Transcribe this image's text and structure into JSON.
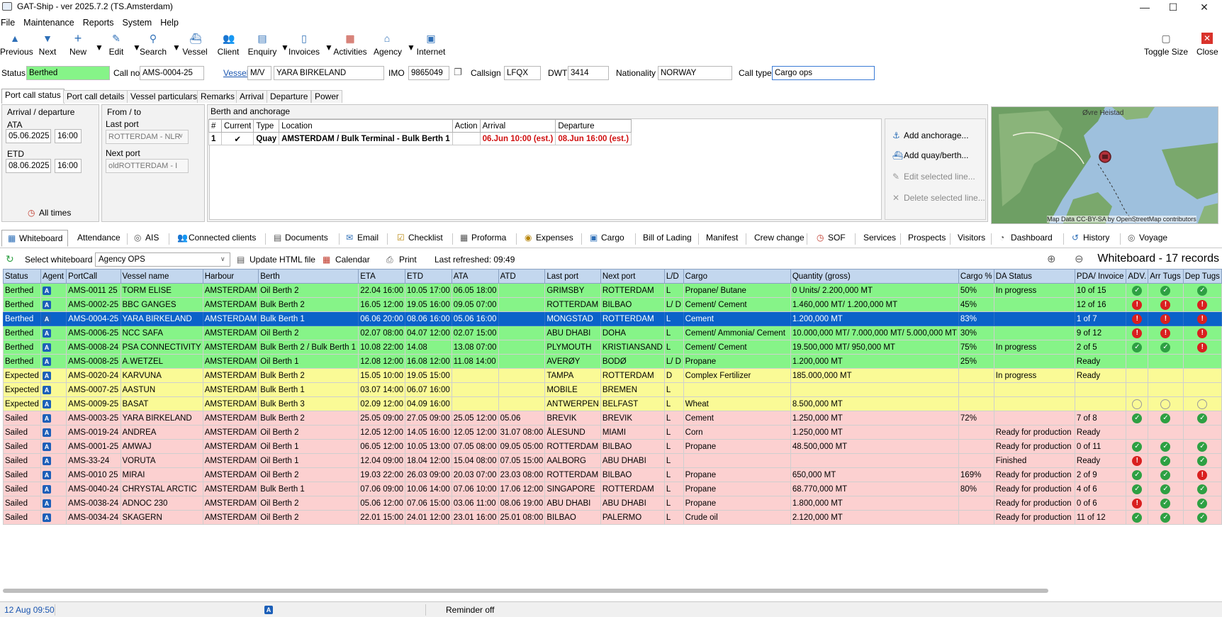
{
  "window": {
    "title": "GAT-Ship - ver 2025.7.2 (TS.Amsterdam)",
    "minimize": "—",
    "maximize": "☐",
    "close": "✕"
  },
  "menu": [
    "File",
    "Maintenance",
    "Reports",
    "System",
    "Help"
  ],
  "toolbar": {
    "previous": "Previous",
    "next": "Next",
    "new": "New",
    "edit": "Edit",
    "search": "Search",
    "vessel": "Vessel",
    "client": "Client",
    "enquiry": "Enquiry",
    "invoices": "Invoices",
    "activities": "Activities",
    "agency": "Agency",
    "internet": "Internet",
    "toggle_size": "Toggle Size",
    "close": "Close"
  },
  "info": {
    "status_label": "Status",
    "status_value": "Berthed",
    "callno_label": "Call no",
    "callno_value": "AMS-0004-25",
    "vessel_label": "Vessel",
    "vessel_prefix": "M/V",
    "vessel_name": "YARA BIRKELAND",
    "imo_label": "IMO",
    "imo_value": "9865049",
    "callsign_label": "Callsign",
    "callsign_value": "LFQX",
    "dwt_label": "DWT",
    "dwt_value": "3414",
    "nationality_label": "Nationality",
    "nationality_value": "NORWAY",
    "calltype_label": "Call type",
    "calltype_value": "Cargo ops"
  },
  "upper_tabs": [
    "Port call status",
    "Port call details",
    "Vessel particulars",
    "Remarks",
    "Arrival",
    "Departure",
    "Power"
  ],
  "arrival": {
    "title": "Arrival / departure",
    "ata_label": "ATA",
    "ata_date": "05.06.2025",
    "ata_time": "16:00",
    "etd_label": "ETD",
    "etd_date": "08.06.2025",
    "etd_time": "16:00",
    "all_times": "All times"
  },
  "fromto": {
    "title": "From / to",
    "last_port_label": "Last port",
    "last_port_value": "ROTTERDAM - NLR",
    "next_port_label": "Next port",
    "next_port_value": "oldROTTERDAM - I"
  },
  "berth": {
    "title": "Berth and anchorage",
    "headers": [
      "#",
      "Current",
      "Type",
      "Location",
      "Action",
      "Arrival",
      "Departure"
    ],
    "row": {
      "num": "1",
      "current": "✔",
      "type": "Quay",
      "location": "AMSTERDAM / Bulk Terminal - Bulk Berth 1",
      "action": "",
      "arrival": "06.Jun 10:00 (est.)",
      "departure": "08.Jun 16:00 (est.)"
    },
    "actions": {
      "add_anchorage": "Add anchorage...",
      "add_quay": "Add quay/berth...",
      "edit": "Edit selected line...",
      "delete": "Delete selected line..."
    }
  },
  "map": {
    "label": "Øvre Heistad",
    "attribution": "Map Data CC-BY-SA by OpenStreetMap contributors"
  },
  "lower_tabs": [
    "Whiteboard",
    "Attendance",
    "AIS",
    "Connected clients",
    "Documents",
    "Email",
    "Checklist",
    "Proforma",
    "Expenses",
    "Cargo",
    "Bill of Lading",
    "Manifest",
    "Crew change",
    "SOF",
    "Services",
    "Prospects",
    "Visitors",
    "Dashboard",
    "History",
    "Voyage"
  ],
  "whiteboard": {
    "select_label": "Select whiteboard",
    "select_value": "Agency OPS",
    "update_html": "Update HTML file",
    "calendar": "Calendar",
    "print": "Print",
    "last_refreshed": "Last refreshed: 09:49",
    "title": "Whiteboard - 17 records",
    "columns": [
      "Status",
      "Agent",
      "PortCall",
      "Vessel name",
      "Harbour",
      "Berth",
      "ETA",
      "ETD",
      "ATA",
      "ATD",
      "Last port",
      "Next port",
      "L/D",
      "Cargo",
      "Quantity (gross)",
      "Cargo %",
      "DA Status",
      "PDA/ Invoice",
      "ADV.",
      "Arr Tugs",
      "Dep Tugs"
    ],
    "rows": [
      {
        "cls": "berthed",
        "cells": [
          "Berthed",
          "A",
          "AMS-0011 25",
          "TORM ELISE",
          "AMSTERDAM",
          "Oil Berth 2",
          "22.04 16:00",
          "10.05 17:00",
          "06.05 18:00",
          "",
          "GRIMSBY",
          "ROTTERDAM",
          "L",
          "Propane/ Butane",
          "0 Units/ 2.200,000 MT",
          "50%",
          "In progress",
          "10 of 15"
        ],
        "adv": "ok",
        "arr": "ok",
        "dep": "ok"
      },
      {
        "cls": "berthed",
        "cells": [
          "Berthed",
          "A",
          "AMS-0002-25",
          "BBC GANGES",
          "AMSTERDAM",
          "Bulk Berth 2",
          "16.05 12:00",
          "19.05 16:00",
          "09.05 07:00",
          "",
          "ROTTERDAM",
          "BILBAO",
          "L/ D",
          "Cement/ Cement",
          "1.460,000 MT/ 1.200,000 MT",
          "45%",
          "",
          "12 of 16"
        ],
        "adv": "warn",
        "arr": "warn",
        "dep": "warn"
      },
      {
        "cls": "selected",
        "cells": [
          "Berthed",
          "A",
          "AMS-0004-25",
          "YARA BIRKELAND",
          "AMSTERDAM",
          "Bulk Berth 1",
          "06.06 20:00",
          "08.06 16:00",
          "05.06 16:00",
          "",
          "MONGSTAD",
          "ROTTERDAM",
          "L",
          "Cement",
          "1.200,000 MT",
          "83%",
          "",
          "1 of 7"
        ],
        "adv": "warn",
        "arr": "warn",
        "dep": "warn"
      },
      {
        "cls": "berthed",
        "cells": [
          "Berthed",
          "A",
          "AMS-0006-25",
          "NCC SAFA",
          "AMSTERDAM",
          "Oil Berth 2",
          "02.07 08:00",
          "04.07 12:00",
          "02.07 15:00",
          "",
          "ABU DHABI",
          "DOHA",
          "L",
          "Cement/ Ammonia/ Cement",
          "10.000,000 MT/ 7.000,000 MT/ 5.000,000 MT",
          "30%",
          "",
          "9 of 12"
        ],
        "adv": "warn",
        "arr": "warn",
        "dep": "warn"
      },
      {
        "cls": "berthed",
        "cells": [
          "Berthed",
          "A",
          "AMS-0008-24",
          "PSA CONNECTIVITY",
          "AMSTERDAM",
          "Bulk Berth 2 / Bulk Berth 1",
          "10.08 22:00",
          "14.08",
          "13.08 07:00",
          "",
          "PLYMOUTH",
          "KRISTIANSAND",
          "L",
          "Cement/ Cement",
          "19.500,000 MT/ 950,000 MT",
          "75%",
          "In progress",
          "2 of 5"
        ],
        "adv": "ok",
        "arr": "ok",
        "dep": "warn"
      },
      {
        "cls": "berthed",
        "cells": [
          "Berthed",
          "A",
          "AMS-0008-25",
          "A.WETZEL",
          "AMSTERDAM",
          "Oil Berth 1",
          "12.08 12:00",
          "16.08 12:00",
          "11.08 14:00",
          "",
          "AVERØY",
          "BODØ",
          "L/ D",
          "Propane",
          "1.200,000 MT",
          "25%",
          "",
          "Ready"
        ],
        "adv": "",
        "arr": "",
        "dep": ""
      },
      {
        "cls": "expected",
        "cells": [
          "Expected",
          "A",
          "AMS-0020-24",
          "KARVUNA",
          "AMSTERDAM",
          "Bulk Berth 2",
          "15.05 10:00",
          "19.05 15:00",
          "",
          "",
          "TAMPA",
          "ROTTERDAM",
          "D",
          "Complex Fertilizer",
          "185.000,000 MT",
          "",
          "In progress",
          "Ready"
        ],
        "adv": "",
        "arr": "",
        "dep": ""
      },
      {
        "cls": "expected",
        "cells": [
          "Expected",
          "A",
          "AMS-0007-25",
          "AASTUN",
          "AMSTERDAM",
          "Bulk Berth 1",
          "03.07 14:00",
          "06.07 16:00",
          "",
          "",
          "MOBILE",
          "BREMEN",
          "L",
          "",
          "",
          "",
          "",
          ""
        ],
        "adv": "",
        "arr": "",
        "dep": ""
      },
      {
        "cls": "expected",
        "cells": [
          "Expected",
          "A",
          "AMS-0009-25",
          "BASAT",
          "AMSTERDAM",
          "Bulk Berth 3",
          "02.09 12:00",
          "04.09 16:00",
          "",
          "",
          "ANTWERPEN",
          "BELFAST",
          "L",
          "Wheat",
          "8.500,000 MT",
          "",
          "",
          ""
        ],
        "adv": "empty",
        "arr": "empty",
        "dep": "empty"
      },
      {
        "cls": "sailed",
        "cells": [
          "Sailed",
          "A",
          "AMS-0003-25",
          "YARA BIRKELAND",
          "AMSTERDAM",
          "Bulk Berth 2",
          "25.05 09:00",
          "27.05 09:00",
          "25.05 12:00",
          "05.06",
          "BREVIK",
          "BREVIK",
          "L",
          "Cement",
          "1.250,000 MT",
          "72%",
          "",
          "7 of 8"
        ],
        "adv": "ok",
        "arr": "ok",
        "dep": "ok"
      },
      {
        "cls": "sailed",
        "cells": [
          "Sailed",
          "A",
          "AMS-0019-24",
          "ANDREA",
          "AMSTERDAM",
          "Oil Berth 2",
          "12.05 12:00",
          "14.05 16:00",
          "12.05 12:00",
          "31.07 08:00",
          "ÅLESUND",
          "MIAMI",
          "L",
          "Corn",
          "1.250,000 MT",
          "",
          "Ready for production",
          "Ready"
        ],
        "adv": "",
        "arr": "",
        "dep": ""
      },
      {
        "cls": "sailed",
        "cells": [
          "Sailed",
          "A",
          "AMS-0001-25",
          "AMWAJ",
          "AMSTERDAM",
          "Oil Berth 1",
          "06.05 12:00",
          "10.05 13:00",
          "07.05 08:00",
          "09.05 05:00",
          "ROTTERDAM",
          "BILBAO",
          "L",
          "Propane",
          "48.500,000 MT",
          "",
          "Ready for production",
          "0 of 11"
        ],
        "adv": "ok",
        "arr": "ok",
        "dep": "ok"
      },
      {
        "cls": "sailed",
        "cells": [
          "Sailed",
          "A",
          "AMS-33-24",
          "VORUTA",
          "AMSTERDAM",
          "Oil Berth 1",
          "12.04 09:00",
          "18.04 12:00",
          "15.04 08:00",
          "07.05 15:00",
          "AALBORG",
          "ABU DHABI",
          "L",
          "",
          "",
          "",
          "Finished",
          "Ready"
        ],
        "adv": "warn",
        "arr": "ok",
        "dep": "ok"
      },
      {
        "cls": "sailed",
        "cells": [
          "Sailed",
          "A",
          "AMS-0010 25",
          "MIRAI",
          "AMSTERDAM",
          "Oil Berth 2",
          "19.03 22:00",
          "26.03 09:00",
          "20.03 07:00",
          "23.03 08:00",
          "ROTTERDAM",
          "BILBAO",
          "L",
          "Propane",
          "650,000 MT",
          "169%",
          "Ready for production",
          "2 of 9"
        ],
        "adv": "ok",
        "arr": "ok",
        "dep": "warn"
      },
      {
        "cls": "sailed",
        "cells": [
          "Sailed",
          "A",
          "AMS-0040-24",
          "CHRYSTAL ARCTIC",
          "AMSTERDAM",
          "Bulk Berth 1",
          "07.06 09:00",
          "10.06 14:00",
          "07.06 10:00",
          "17.06 12:00",
          "SINGAPORE",
          "ROTTERDAM",
          "L",
          "Propane",
          "68.770,000 MT",
          "80%",
          "Ready for production",
          "4 of 6"
        ],
        "adv": "ok",
        "arr": "ok",
        "dep": "ok"
      },
      {
        "cls": "sailed",
        "cells": [
          "Sailed",
          "A",
          "AMS-0038-24",
          "ADNOC 230",
          "AMSTERDAM",
          "Oil Berth 2",
          "05.06 12:00",
          "07.06 15:00",
          "03.06 11:00",
          "08.06 19:00",
          "ABU DHABI",
          "ABU DHABI",
          "L",
          "Propane",
          "1.800,000 MT",
          "",
          "Ready for production",
          "0 of 6"
        ],
        "adv": "warn",
        "arr": "ok",
        "dep": "ok"
      },
      {
        "cls": "sailed",
        "cells": [
          "Sailed",
          "A",
          "AMS-0034-24",
          "SKAGERN",
          "AMSTERDAM",
          "Oil Berth 2",
          "22.01 15:00",
          "24.01 12:00",
          "23.01 16:00",
          "25.01 08:00",
          "BILBAO",
          "PALERMO",
          "L",
          "Crude oil",
          "2.120,000 MT",
          "",
          "Ready for production",
          "11 of 12"
        ],
        "adv": "ok",
        "arr": "ok",
        "dep": "ok"
      }
    ]
  },
  "statusbar": {
    "date": "12 Aug 09:50",
    "agent": "A",
    "reminder": "Reminder off"
  }
}
